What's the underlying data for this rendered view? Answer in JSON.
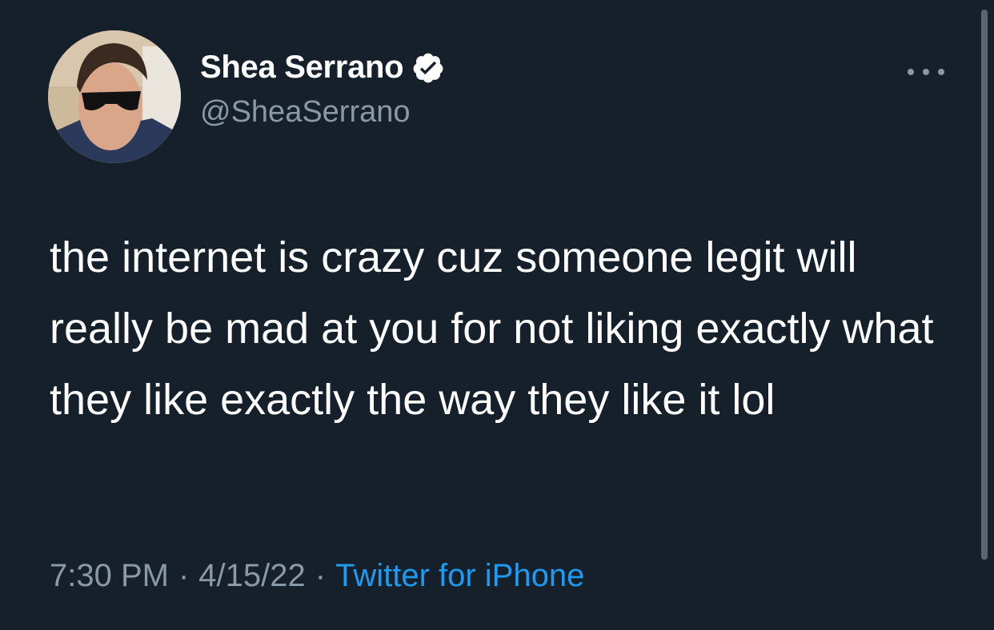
{
  "tweet": {
    "author": {
      "display_name": "Shea Serrano",
      "handle": "@SheaSerrano",
      "verified": true,
      "avatar_icon": "profile-photo"
    },
    "more_icon": "ellipsis-icon",
    "text": "the internet is crazy cuz someone legit will really be mad at you for not liking exactly what they like exactly the way they like it lol",
    "meta": {
      "time": "7:30 PM",
      "separator": "·",
      "date": "4/15/22",
      "source": "Twitter for iPhone"
    }
  },
  "colors": {
    "background": "#15202b",
    "text_primary": "#ffffff",
    "text_secondary": "#8b98a5",
    "link": "#1d9bf0"
  }
}
